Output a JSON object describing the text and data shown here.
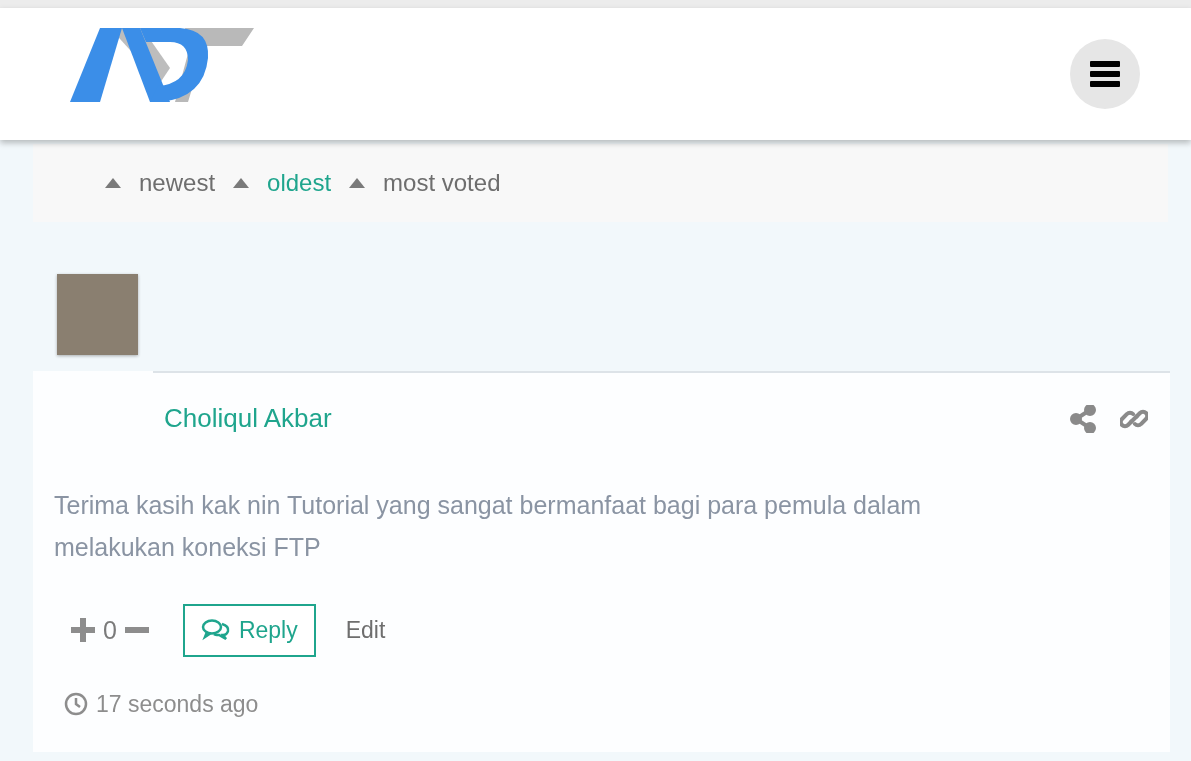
{
  "sort_options": [
    {
      "label": "newest",
      "selected": false
    },
    {
      "label": "oldest",
      "selected": true
    },
    {
      "label": "most voted",
      "selected": false
    }
  ],
  "comment": {
    "author": "Choliqul Akbar",
    "text": "Terima kasih kak nin Tutorial yang sangat bermanfaat bagi para pemula dalam melakukan koneksi FTP",
    "votes": "0",
    "reply_label": "Reply",
    "edit_label": "Edit",
    "time": "17 seconds ago"
  }
}
